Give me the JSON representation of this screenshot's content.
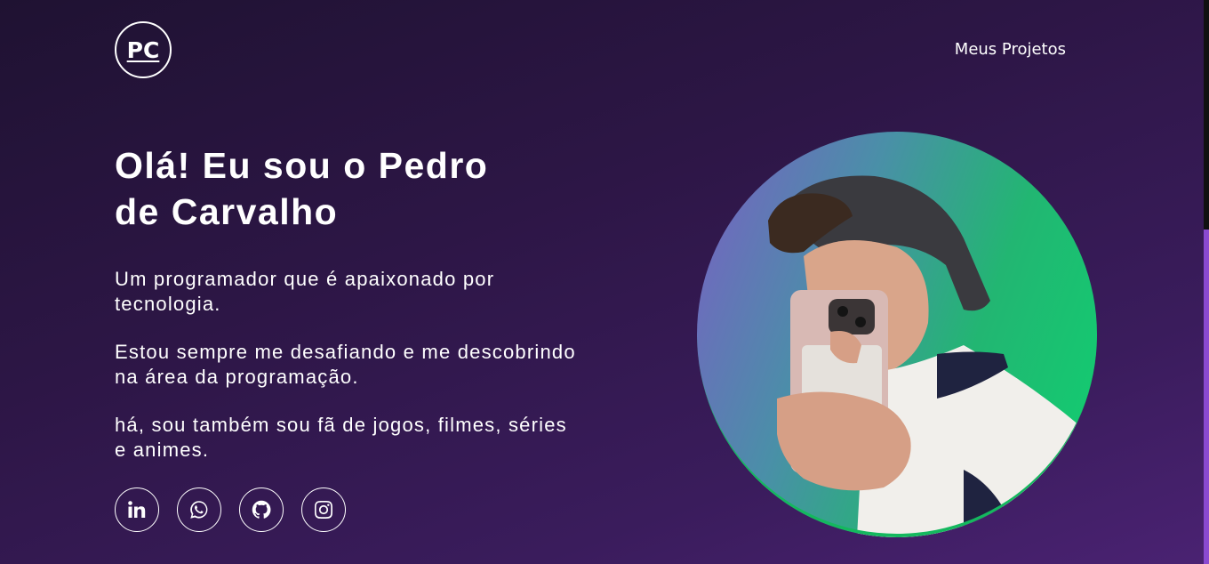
{
  "header": {
    "logo_text": "PC",
    "nav_link": "Meus Projetos"
  },
  "hero": {
    "title_line1": "Olá! Eu sou o Pedro",
    "title_line2": "de Carvalho",
    "paragraphs": [
      "Um programador que é apaixonado por tecnologia.",
      "Estou sempre me desafiando e me descobrindo na área da programação.",
      "há, sou também sou fã de jogos, filmes, séries e animes."
    ]
  },
  "socials": [
    {
      "name": "linkedin-icon"
    },
    {
      "name": "whatsapp-icon"
    },
    {
      "name": "github-icon"
    },
    {
      "name": "instagram-icon"
    }
  ],
  "colors": {
    "background_start": "#1f1232",
    "background_end": "#4a2272",
    "avatar_gradient_start": "#7a5fc4",
    "avatar_gradient_end": "#0fd070"
  }
}
